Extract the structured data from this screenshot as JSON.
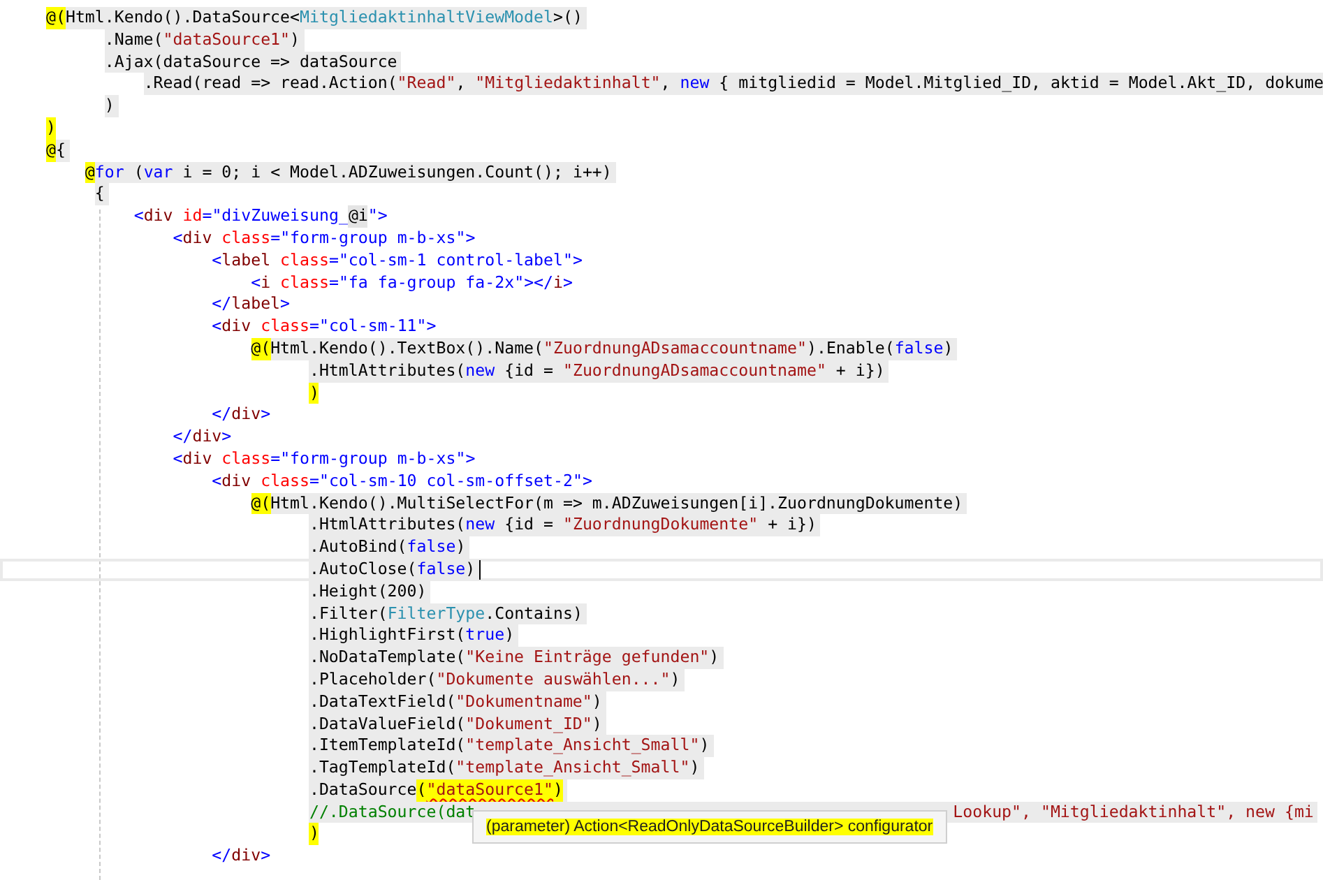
{
  "editor": {
    "lines": [
      {
        "shaded": true,
        "current": false,
        "tokens": [
          {
            "kind": "razor",
            "text": "@("
          },
          {
            "kind": "plain",
            "text": "Html.Kendo().DataSource<"
          },
          {
            "kind": "type",
            "text": "MitgliedaktinhaltViewModel"
          },
          {
            "kind": "plain",
            "text": ">()"
          }
        ]
      },
      {
        "shaded": true,
        "current": false,
        "tokens": [
          {
            "kind": "plain",
            "text": "      .Name("
          },
          {
            "kind": "string",
            "text": "\"dataSource1\""
          },
          {
            "kind": "plain",
            "text": ")"
          }
        ]
      },
      {
        "shaded": true,
        "current": false,
        "tokens": [
          {
            "kind": "plain",
            "text": "      .Ajax(dataSource => dataSource"
          }
        ]
      },
      {
        "shaded": true,
        "current": false,
        "tokens": [
          {
            "kind": "plain",
            "text": "          .Read(read => read.Action("
          },
          {
            "kind": "string",
            "text": "\"Read\""
          },
          {
            "kind": "plain",
            "text": ", "
          },
          {
            "kind": "string",
            "text": "\"Mitgliedaktinhalt\""
          },
          {
            "kind": "plain",
            "text": ", "
          },
          {
            "kind": "keyword",
            "text": "new"
          },
          {
            "kind": "plain",
            "text": " { mitgliedid = Model.Mitglied_ID, aktid = Model.Akt_ID, dokume"
          }
        ]
      },
      {
        "shaded": true,
        "current": false,
        "tokens": [
          {
            "kind": "plain",
            "text": "      )"
          }
        ]
      },
      {
        "shaded": false,
        "current": false,
        "tokens": [
          {
            "kind": "razor",
            "text": ")"
          }
        ]
      },
      {
        "shaded": true,
        "current": false,
        "tokens": [
          {
            "kind": "razor",
            "text": "@"
          },
          {
            "kind": "plain",
            "text": "{"
          }
        ]
      },
      {
        "shaded": true,
        "current": false,
        "tokens": [
          {
            "kind": "razor",
            "text": "    @"
          },
          {
            "kind": "keyword",
            "text": "for"
          },
          {
            "kind": "plain",
            "text": " ("
          },
          {
            "kind": "keyword",
            "text": "var"
          },
          {
            "kind": "plain",
            "text": " i = 0; i < Model.ADZuweisungen.Count(); i++)"
          }
        ]
      },
      {
        "shaded": true,
        "current": false,
        "tokens": [
          {
            "kind": "plain",
            "text": "     {"
          }
        ]
      },
      {
        "shaded": false,
        "current": false,
        "tokens": [
          {
            "kind": "bracket",
            "text": "         <"
          },
          {
            "kind": "tag",
            "text": "div"
          },
          {
            "kind": "attr",
            "text": " id"
          },
          {
            "kind": "bracket",
            "text": "="
          },
          {
            "kind": "value",
            "text": "\"divZuweisung_"
          },
          {
            "kind": "inline",
            "text": "@i"
          },
          {
            "kind": "value",
            "text": "\""
          },
          {
            "kind": "bracket",
            "text": ">"
          }
        ]
      },
      {
        "shaded": false,
        "current": false,
        "tokens": [
          {
            "kind": "bracket",
            "text": "             <"
          },
          {
            "kind": "tag",
            "text": "div"
          },
          {
            "kind": "attr",
            "text": " class"
          },
          {
            "kind": "bracket",
            "text": "="
          },
          {
            "kind": "value",
            "text": "\"form-group m-b-xs\""
          },
          {
            "kind": "bracket",
            "text": ">"
          }
        ]
      },
      {
        "shaded": false,
        "current": false,
        "tokens": [
          {
            "kind": "bracket",
            "text": "                 <"
          },
          {
            "kind": "tag",
            "text": "label"
          },
          {
            "kind": "attr",
            "text": " class"
          },
          {
            "kind": "bracket",
            "text": "="
          },
          {
            "kind": "value",
            "text": "\"col-sm-1 control-label\""
          },
          {
            "kind": "bracket",
            "text": ">"
          }
        ]
      },
      {
        "shaded": false,
        "current": false,
        "tokens": [
          {
            "kind": "bracket",
            "text": "                     <"
          },
          {
            "kind": "tag",
            "text": "i"
          },
          {
            "kind": "attr",
            "text": " class"
          },
          {
            "kind": "bracket",
            "text": "="
          },
          {
            "kind": "value",
            "text": "\"fa fa-group fa-2x\""
          },
          {
            "kind": "bracket",
            "text": "></"
          },
          {
            "kind": "tag",
            "text": "i"
          },
          {
            "kind": "bracket",
            "text": ">"
          }
        ]
      },
      {
        "shaded": false,
        "current": false,
        "tokens": [
          {
            "kind": "bracket",
            "text": "                 </"
          },
          {
            "kind": "tag",
            "text": "label"
          },
          {
            "kind": "bracket",
            "text": ">"
          }
        ]
      },
      {
        "shaded": false,
        "current": false,
        "tokens": [
          {
            "kind": "bracket",
            "text": "                 <"
          },
          {
            "kind": "tag",
            "text": "div"
          },
          {
            "kind": "attr",
            "text": " class"
          },
          {
            "kind": "bracket",
            "text": "="
          },
          {
            "kind": "value",
            "text": "\"col-sm-11\""
          },
          {
            "kind": "bracket",
            "text": ">"
          }
        ]
      },
      {
        "shaded": true,
        "current": false,
        "tokens": [
          {
            "kind": "razor",
            "text": "                     @("
          },
          {
            "kind": "plain",
            "text": "Html.Kendo().TextBox().Name("
          },
          {
            "kind": "string",
            "text": "\"ZuordnungADsamaccountname\""
          },
          {
            "kind": "plain",
            "text": ").Enable("
          },
          {
            "kind": "keyword",
            "text": "false"
          },
          {
            "kind": "plain",
            "text": ")"
          }
        ]
      },
      {
        "shaded": true,
        "current": false,
        "tokens": [
          {
            "kind": "plain",
            "text": "                           .HtmlAttributes("
          },
          {
            "kind": "keyword",
            "text": "new"
          },
          {
            "kind": "plain",
            "text": " {id = "
          },
          {
            "kind": "string",
            "text": "\"ZuordnungADsamaccountname\""
          },
          {
            "kind": "plain",
            "text": " + i})"
          }
        ]
      },
      {
        "shaded": false,
        "current": false,
        "tokens": [
          {
            "kind": "razor",
            "text": "                           )"
          }
        ]
      },
      {
        "shaded": false,
        "current": false,
        "tokens": [
          {
            "kind": "bracket",
            "text": "                 </"
          },
          {
            "kind": "tag",
            "text": "div"
          },
          {
            "kind": "bracket",
            "text": ">"
          }
        ]
      },
      {
        "shaded": false,
        "current": false,
        "tokens": [
          {
            "kind": "bracket",
            "text": "             </"
          },
          {
            "kind": "tag",
            "text": "div"
          },
          {
            "kind": "bracket",
            "text": ">"
          }
        ]
      },
      {
        "shaded": false,
        "current": false,
        "tokens": [
          {
            "kind": "bracket",
            "text": "             <"
          },
          {
            "kind": "tag",
            "text": "div"
          },
          {
            "kind": "attr",
            "text": " class"
          },
          {
            "kind": "bracket",
            "text": "="
          },
          {
            "kind": "value",
            "text": "\"form-group m-b-xs\""
          },
          {
            "kind": "bracket",
            "text": ">"
          }
        ]
      },
      {
        "shaded": false,
        "current": false,
        "tokens": [
          {
            "kind": "bracket",
            "text": "                 <"
          },
          {
            "kind": "tag",
            "text": "div"
          },
          {
            "kind": "attr",
            "text": " class"
          },
          {
            "kind": "bracket",
            "text": "="
          },
          {
            "kind": "value",
            "text": "\"col-sm-10 col-sm-offset-2\""
          },
          {
            "kind": "bracket",
            "text": ">"
          }
        ]
      },
      {
        "shaded": true,
        "current": false,
        "tokens": [
          {
            "kind": "razor",
            "text": "                     @("
          },
          {
            "kind": "plain",
            "text": "Html.Kendo().MultiSelectFor(m => m.ADZuweisungen[i].ZuordnungDokumente)"
          }
        ]
      },
      {
        "shaded": true,
        "current": false,
        "tokens": [
          {
            "kind": "plain",
            "text": "                           .HtmlAttributes("
          },
          {
            "kind": "keyword",
            "text": "new"
          },
          {
            "kind": "plain",
            "text": " {id = "
          },
          {
            "kind": "string",
            "text": "\"ZuordnungDokumente\""
          },
          {
            "kind": "plain",
            "text": " + i})"
          }
        ]
      },
      {
        "shaded": true,
        "current": false,
        "tokens": [
          {
            "kind": "plain",
            "text": "                           .AutoBind("
          },
          {
            "kind": "keyword",
            "text": "false"
          },
          {
            "kind": "plain",
            "text": ")"
          }
        ]
      },
      {
        "shaded": true,
        "current": true,
        "tokens": [
          {
            "kind": "plain",
            "text": "                           .AutoClose("
          },
          {
            "kind": "keyword",
            "text": "false"
          },
          {
            "kind": "plain",
            "text": ")"
          }
        ]
      },
      {
        "shaded": true,
        "current": false,
        "tokens": [
          {
            "kind": "plain",
            "text": "                           .Height(200)"
          }
        ]
      },
      {
        "shaded": true,
        "current": false,
        "tokens": [
          {
            "kind": "plain",
            "text": "                           .Filter("
          },
          {
            "kind": "type",
            "text": "FilterType"
          },
          {
            "kind": "plain",
            "text": ".Contains)"
          }
        ]
      },
      {
        "shaded": true,
        "current": false,
        "tokens": [
          {
            "kind": "plain",
            "text": "                           .HighlightFirst("
          },
          {
            "kind": "keyword",
            "text": "true"
          },
          {
            "kind": "plain",
            "text": ")"
          }
        ]
      },
      {
        "shaded": true,
        "current": false,
        "tokens": [
          {
            "kind": "plain",
            "text": "                           .NoDataTemplate("
          },
          {
            "kind": "string",
            "text": "\"Keine Einträge gefunden\""
          },
          {
            "kind": "plain",
            "text": ")"
          }
        ]
      },
      {
        "shaded": true,
        "current": false,
        "tokens": [
          {
            "kind": "plain",
            "text": "                           .Placeholder("
          },
          {
            "kind": "string",
            "text": "\"Dokumente auswählen...\""
          },
          {
            "kind": "plain",
            "text": ")"
          }
        ]
      },
      {
        "shaded": true,
        "current": false,
        "tokens": [
          {
            "kind": "plain",
            "text": "                           .DataTextField("
          },
          {
            "kind": "string",
            "text": "\"Dokumentname\""
          },
          {
            "kind": "plain",
            "text": ")"
          }
        ]
      },
      {
        "shaded": true,
        "current": false,
        "tokens": [
          {
            "kind": "plain",
            "text": "                           .DataValueField("
          },
          {
            "kind": "string",
            "text": "\"Dokument_ID\""
          },
          {
            "kind": "plain",
            "text": ")"
          }
        ]
      },
      {
        "shaded": true,
        "current": false,
        "tokens": [
          {
            "kind": "plain",
            "text": "                           .ItemTemplateId("
          },
          {
            "kind": "string",
            "text": "\"template_Ansicht_Small\""
          },
          {
            "kind": "plain",
            "text": ")"
          }
        ]
      },
      {
        "shaded": true,
        "current": false,
        "tokens": [
          {
            "kind": "plain",
            "text": "                           .TagTemplateId("
          },
          {
            "kind": "string",
            "text": "\"template_Ansicht_Small\""
          },
          {
            "kind": "plain",
            "text": ")"
          }
        ]
      },
      {
        "shaded": true,
        "current": false,
        "tokens": [
          {
            "kind": "plain",
            "text": "                           .DataSource"
          },
          {
            "kind": "match",
            "text": "("
          },
          {
            "kind": "error",
            "text": "\"dataSource1\""
          },
          {
            "kind": "match",
            "text": ")"
          }
        ]
      },
      {
        "shaded": true,
        "current": false,
        "tokens": [
          {
            "kind": "comment",
            "text": "                           //.DataSource(dat"
          },
          {
            "kind": "covered",
            "text": "Lookup\", \"Mitgliedaktinhalt\", new {mi"
          }
        ]
      },
      {
        "shaded": false,
        "current": false,
        "tokens": [
          {
            "kind": "razor",
            "text": "                           )"
          }
        ]
      },
      {
        "shaded": false,
        "current": false,
        "tokens": [
          {
            "kind": "bracket",
            "text": "                 </"
          },
          {
            "kind": "tag",
            "text": "div"
          },
          {
            "kind": "bracket",
            "text": ">"
          }
        ]
      }
    ]
  },
  "tooltip": {
    "text": "(parameter) Action<ReadOnlyDataSourceBuilder> configurator"
  }
}
